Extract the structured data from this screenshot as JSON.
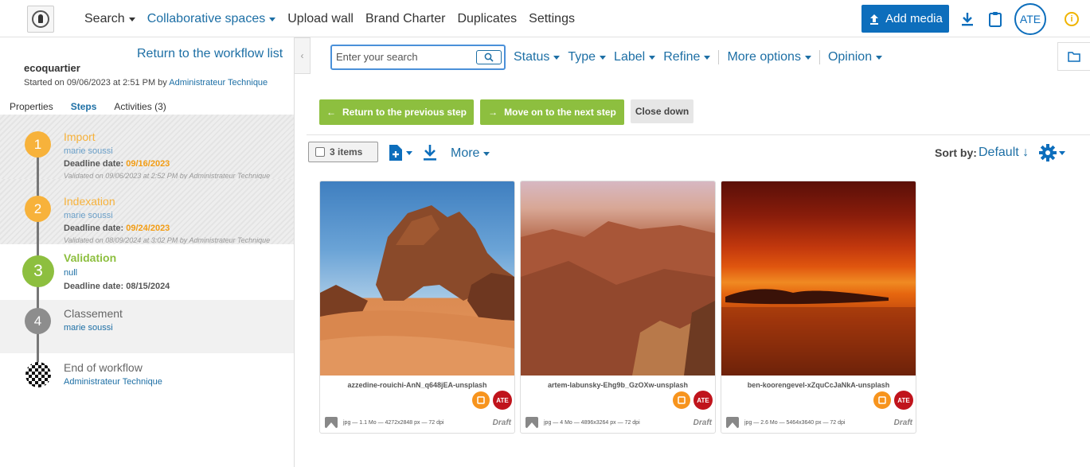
{
  "topbar": {
    "nav": [
      {
        "label": "Search",
        "has_caret": true,
        "active": false
      },
      {
        "label": "Collaborative spaces",
        "has_caret": true,
        "active": true
      },
      {
        "label": "Upload wall",
        "has_caret": false,
        "active": false
      },
      {
        "label": "Brand Charter",
        "has_caret": false,
        "active": false
      },
      {
        "label": "Duplicates",
        "has_caret": false,
        "active": false
      },
      {
        "label": "Settings",
        "has_caret": false,
        "active": false
      }
    ],
    "add_media_label": "Add media",
    "avatar_initials": "ATE",
    "icons": [
      "download-icon",
      "clipboard-icon",
      "info-icon"
    ],
    "accent_color": "#0d6ebc"
  },
  "sidebar": {
    "return_label": "Return to the workflow list",
    "workflow_name": "ecoquartier",
    "started_prefix": "Started on 09/06/2023 at 2:51 PM by ",
    "started_by": "Administrateur Technique",
    "tabs": [
      {
        "label": "Properties",
        "active": false
      },
      {
        "label": "Steps",
        "active": true
      },
      {
        "label": "Activities (3)",
        "active": false
      }
    ],
    "steps": [
      {
        "number": "1",
        "title": "Import",
        "user": "marie soussi",
        "deadline_label": "Deadline date: ",
        "deadline": "09/16/2023",
        "validated": "Validated on 09/06/2023 at 2:52 PM by Administrateur Technique",
        "status": "done"
      },
      {
        "number": "2",
        "title": "Indexation",
        "user": "marie soussi",
        "deadline_label": "Deadline date: ",
        "deadline": "09/24/2023",
        "validated": "Validated on 08/09/2024 at 3:02 PM by Administrateur Technique",
        "status": "done"
      },
      {
        "number": "3",
        "title": "Validation",
        "user": "null",
        "deadline_label": "Deadline date: ",
        "deadline": "08/15/2024",
        "status": "current"
      },
      {
        "number": "4",
        "title": "Classement",
        "user": "marie soussi",
        "status": "future"
      },
      {
        "title": "End of workflow",
        "user": "Administrateur Technique",
        "status": "end"
      }
    ],
    "step_colors": {
      "done": "#f7b23b",
      "current": "#8dbf3f",
      "future": "#8d8d8d"
    }
  },
  "search": {
    "placeholder": "Enter your search",
    "value": ""
  },
  "filters": [
    "Status",
    "Type",
    "Label",
    "Refine",
    "More options",
    "Opinion"
  ],
  "workflow_actions": {
    "previous": "Return to the previous step",
    "next": "Move on to the next step",
    "close": "Close down"
  },
  "toolbar": {
    "items_count": "3 items",
    "more_label": "More",
    "sort_label": "Sort by:",
    "sort_value": "Default ↓"
  },
  "cards": [
    {
      "name": "azzedine-rouichi-AnN_q648jEA-unsplash",
      "meta": "jpg — 1.1 Mo — 4272x2848 px — 72 dpi",
      "status": "Draft",
      "badge": "ATE"
    },
    {
      "name": "artem-labunsky-Ehg9b_GzOXw-unsplash",
      "meta": "jpg — 4 Mo — 4896x3264 px — 72 dpi",
      "status": "Draft",
      "badge": "ATE"
    },
    {
      "name": "ben-koorengevel-xZquCcJaNkA-unsplash",
      "meta": "jpg — 2.6 Mo — 5464x3640 px — 72 dpi",
      "status": "Draft",
      "badge": "ATE"
    }
  ]
}
